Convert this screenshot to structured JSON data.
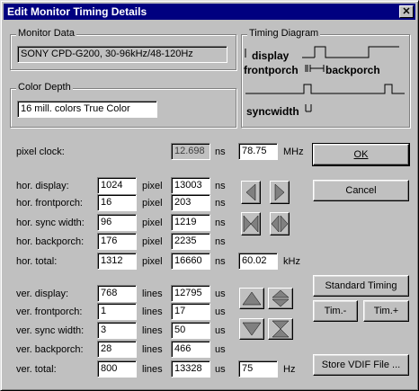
{
  "title": "Edit Monitor Timing Details",
  "close_glyph": "✕",
  "monitor_data": {
    "legend": "Monitor Data",
    "value": "SONY CPD-G200, 30-96kHz/48-120Hz"
  },
  "color_depth": {
    "legend": "Color Depth",
    "value": "16 mill. colors True Color"
  },
  "timing_diagram": {
    "legend": "Timing Diagram",
    "display": "display",
    "frontporch": "frontporch",
    "backporch": "backporch",
    "syncwidth": "syncwidth"
  },
  "pixel_clock": {
    "label": "pixel clock:",
    "ns_value": "12.698",
    "ns_unit": "ns",
    "mhz_value": "78.75",
    "mhz_unit": "MHz"
  },
  "horizontal": [
    {
      "label": "hor. display:",
      "value": "1024",
      "unit": "pixel",
      "time": "13003",
      "time_unit": "ns"
    },
    {
      "label": "hor. frontporch:",
      "value": "16",
      "unit": "pixel",
      "time": "203",
      "time_unit": "ns"
    },
    {
      "label": "hor. sync width:",
      "value": "96",
      "unit": "pixel",
      "time": "1219",
      "time_unit": "ns"
    },
    {
      "label": "hor. backporch:",
      "value": "176",
      "unit": "pixel",
      "time": "2235",
      "time_unit": "ns"
    },
    {
      "label": "hor. total:",
      "value": "1312",
      "unit": "pixel",
      "time": "16660",
      "time_unit": "ns"
    }
  ],
  "hor_freq": {
    "value": "60.02",
    "unit": "kHz"
  },
  "vertical": [
    {
      "label": "ver. display:",
      "value": "768",
      "unit": "lines",
      "time": "12795",
      "time_unit": "us"
    },
    {
      "label": "ver. frontporch:",
      "value": "1",
      "unit": "lines",
      "time": "17",
      "time_unit": "us"
    },
    {
      "label": "ver. sync width:",
      "value": "3",
      "unit": "lines",
      "time": "50",
      "time_unit": "us"
    },
    {
      "label": "ver. backporch:",
      "value": "28",
      "unit": "lines",
      "time": "466",
      "time_unit": "us"
    },
    {
      "label": "ver. total:",
      "value": "800",
      "unit": "lines",
      "time": "13328",
      "time_unit": "us"
    }
  ],
  "ver_freq": {
    "value": "75",
    "unit": "Hz"
  },
  "buttons": {
    "ok": "OK",
    "cancel": "Cancel",
    "standard_timing": "Standard Timing",
    "tim_minus": "Tim.-",
    "tim_plus": "Tim.+",
    "store_vdif": "Store VDIF File ..."
  },
  "colors": {
    "titlebar": "#000080",
    "face": "#c0c0c0",
    "shadow": "#808080",
    "highlight": "#ffffff"
  }
}
